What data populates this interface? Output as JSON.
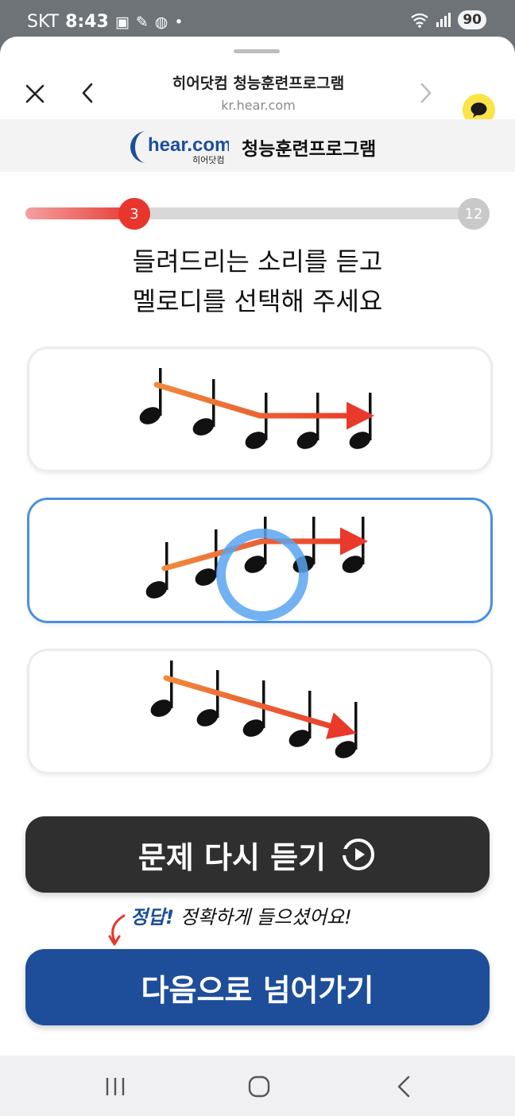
{
  "status": {
    "carrier": "SKT",
    "time": "8:43",
    "battery": "90"
  },
  "header": {
    "title": "히어닷컴 청능훈련프로그램",
    "url": "kr.hear.com"
  },
  "banner": {
    "logo_text": "hear.com",
    "logo_sub": "히어닷컴",
    "title": "청능훈련프로그램"
  },
  "progress": {
    "current": "3",
    "total": "12"
  },
  "instruction": {
    "line1": "들려드리는 소리를 듣고",
    "line2": "멜로디를 선택해 주세요"
  },
  "options": [
    {
      "name": "descending-then-level",
      "selected": false
    },
    {
      "name": "ascending-then-level",
      "selected": true
    },
    {
      "name": "descending",
      "selected": false
    }
  ],
  "buttons": {
    "replay": "문제 다시 듣기",
    "next": "다음으로 넘어가기"
  },
  "feedback": {
    "correct": "정답!",
    "message": "정확하게 들으셨어요!"
  },
  "colors": {
    "accent_red": "#e8362c",
    "selected_blue": "#4a90e2",
    "next_button": "#1e4e9a",
    "replay_button": "#2f2f2f"
  }
}
